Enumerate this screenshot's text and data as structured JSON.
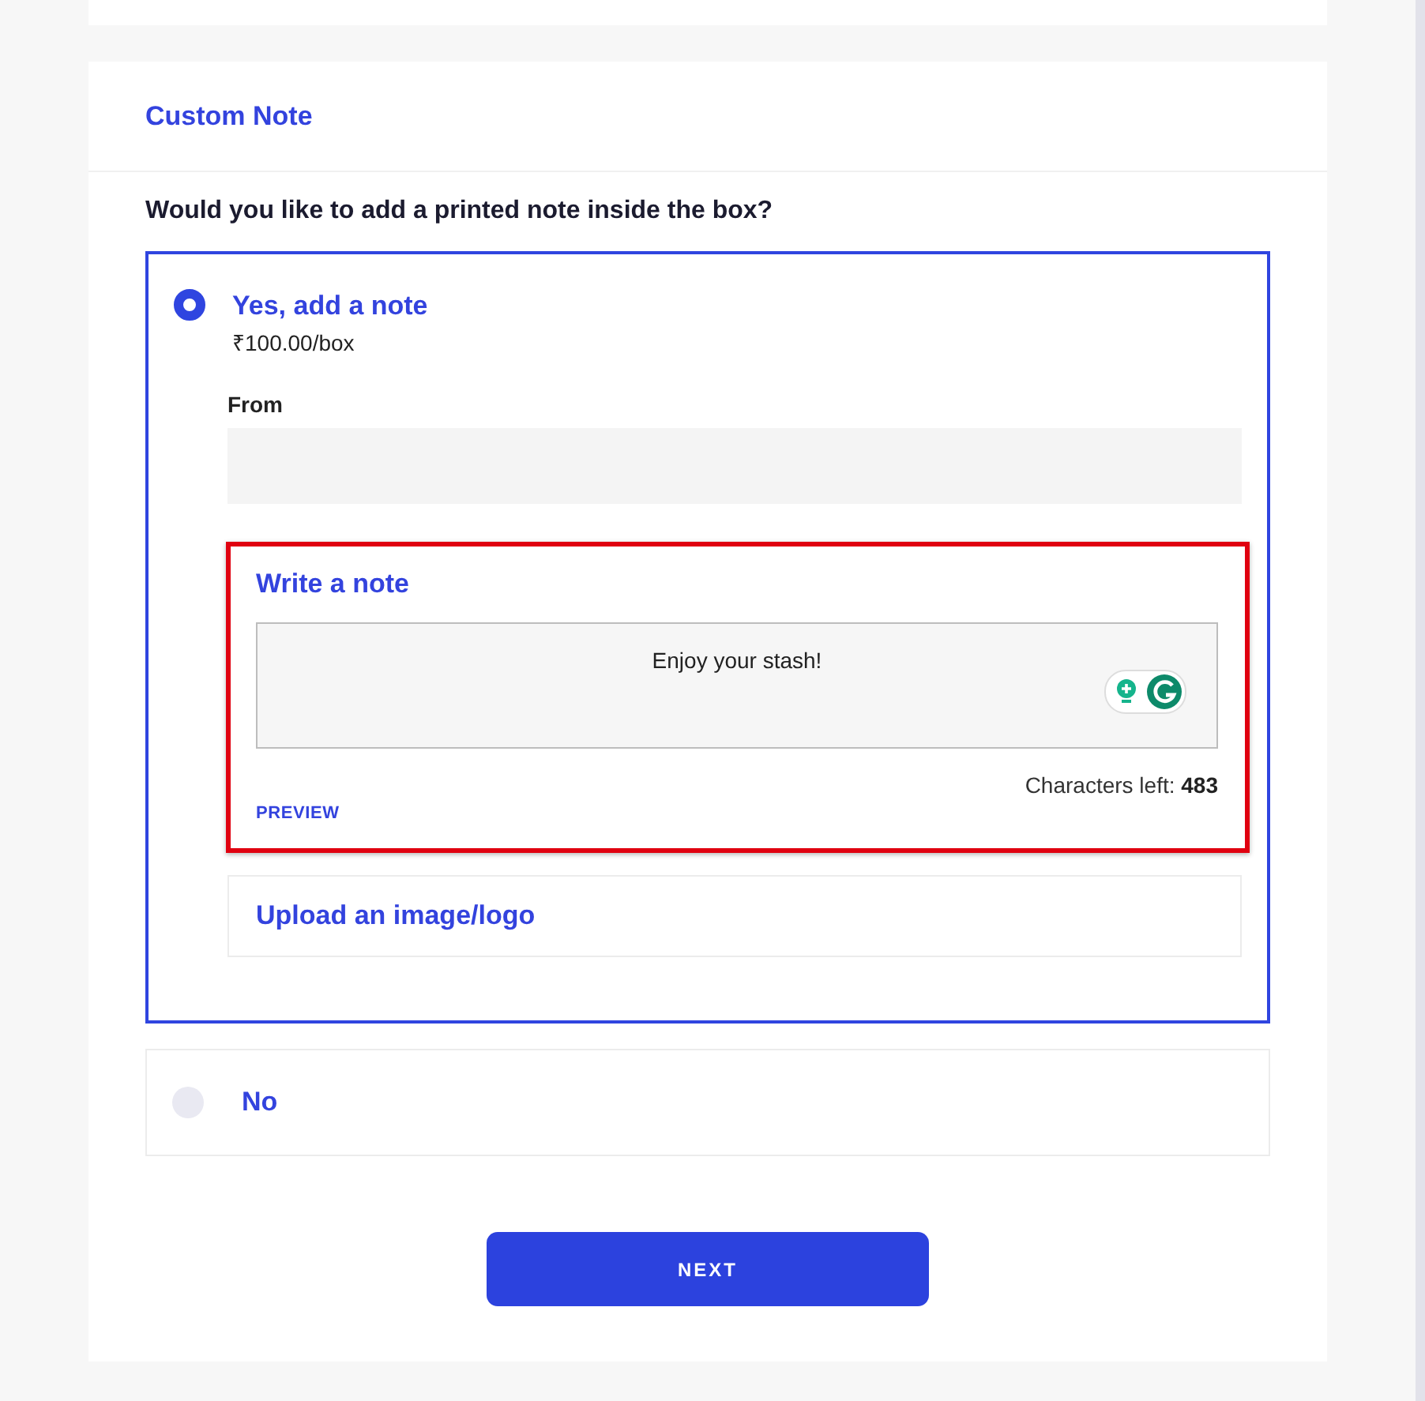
{
  "section_title": "Custom Note",
  "question": "Would you like to add a printed note inside the box?",
  "options": [
    {
      "label": "Yes, add a note",
      "price": "₹100.00/box",
      "selected": true
    },
    {
      "label": "No",
      "selected": false
    }
  ],
  "note_form": {
    "from_label": "From",
    "note_title": "Write a note",
    "note_value": "Enjoy your stash!",
    "characters_left_label": "Characters left:",
    "characters_left": "483",
    "preview_link": "PREVIEW",
    "upload_label": "Upload an image/logo"
  },
  "next_button": "NEXT"
}
